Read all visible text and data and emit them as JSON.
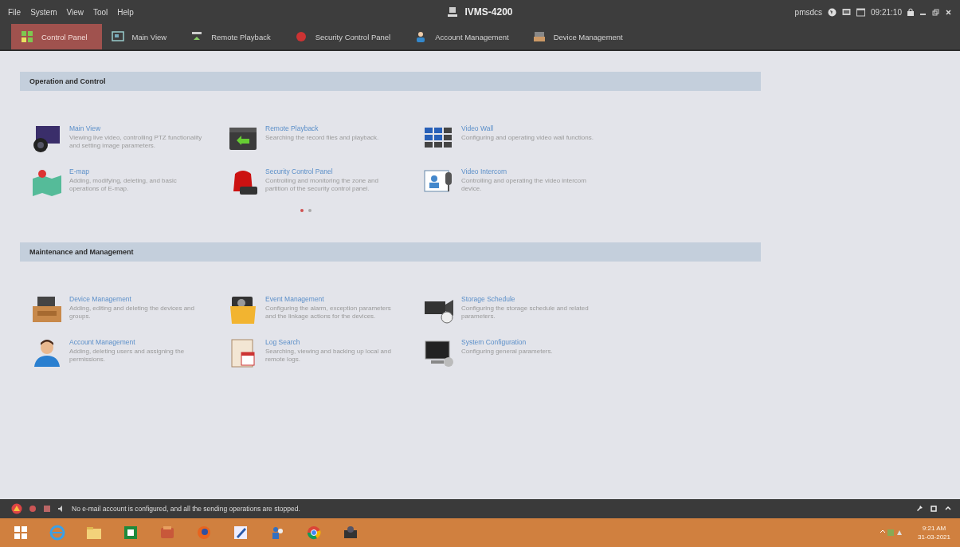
{
  "window": {
    "menu": [
      "File",
      "System",
      "View",
      "Tool",
      "Help"
    ],
    "title": "IVMS-4200",
    "user": "pmsdcs",
    "clock": "09:21:10"
  },
  "tabs": [
    {
      "label": "Control Panel",
      "selected": true
    },
    {
      "label": "Main View",
      "selected": false
    },
    {
      "label": "Remote Playback",
      "selected": false
    },
    {
      "label": "Security Control Panel",
      "selected": false
    },
    {
      "label": "Account Management",
      "selected": false
    },
    {
      "label": "Device Management",
      "selected": false
    }
  ],
  "sections": [
    {
      "title": "Operation and Control",
      "items": [
        {
          "name": "Main View",
          "description": "Viewing live video, controlling PTZ functionality and setting image parameters."
        },
        {
          "name": "Remote Playback",
          "description": "Searching the record files and playback."
        },
        {
          "name": "Video Wall",
          "description": "Configuring and operating video wall functions."
        },
        {
          "name": "E-map",
          "description": "Adding, modifying, deleting, and basic operations of E-map."
        },
        {
          "name": "Security Control Panel",
          "description": "Controlling and monitoring the zone and partition of the security control panel."
        },
        {
          "name": "Video Intercom",
          "description": "Controlling and operating the video intercom device."
        }
      ],
      "pager": [
        {
          "selected": true
        },
        {
          "selected": false
        }
      ]
    },
    {
      "title": "Maintenance and Management",
      "items": [
        {
          "name": "Device Management",
          "description": "Adding, editing and deleting the devices and groups."
        },
        {
          "name": "Event Management",
          "description": "Configuring the alarm, exception parameters and the linkage actions for the devices."
        },
        {
          "name": "Storage Schedule",
          "description": "Configuring the storage schedule and related parameters."
        },
        {
          "name": "Account Management",
          "description": "Adding, deleting users and assigning the permissions."
        },
        {
          "name": "Log Search",
          "description": "Searching, viewing and backing up local and remote logs."
        },
        {
          "name": "System Configuration",
          "description": "Configuring general parameters."
        }
      ]
    }
  ],
  "status_bar": {
    "message": "No e-mail account is configured, and all the sending operations are stopped."
  },
  "taskbar": {
    "time": "9:21 AM",
    "date": "31-03-2021"
  }
}
